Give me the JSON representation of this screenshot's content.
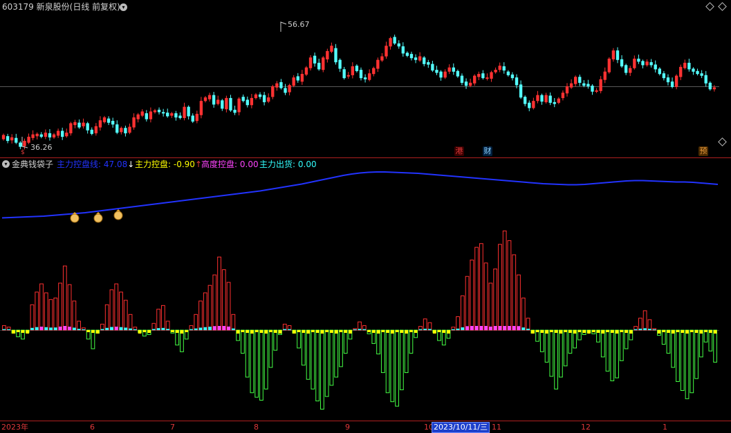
{
  "header": {
    "code": "603179",
    "name": "新泉股份",
    "mode": "(日线 前复权)"
  },
  "price_labels": {
    "high": "56.67",
    "low": "36.26"
  },
  "event_tags": [
    {
      "text": "港",
      "color": "#e03a3a"
    },
    {
      "text": "财",
      "color": "#8fd3ff"
    },
    {
      "text": "预",
      "color": "#e89a3c"
    },
    {
      "text": "$",
      "color": "#e03a3a"
    }
  ],
  "indicator": {
    "name": "金典钱袋子",
    "line1_label": "主力控盘线:",
    "line1_value": "47.08",
    "line1_arrow": "↓",
    "line2_label": "主力控盘:",
    "line2_value": "-0.90",
    "line2_arrow": "↑",
    "line3_label": "高度控盘:",
    "line3_value": "0.00",
    "line4_label": "主力出货:",
    "line4_value": "0.00",
    "colors": {
      "line1": "#2233ff",
      "line2": "#ffff00",
      "line3": "#ff44ff",
      "line4": "#33ffff"
    }
  },
  "x_axis": {
    "labels": [
      "2023年",
      "6",
      "7",
      "8",
      "9",
      "10",
      "11",
      "12",
      "1"
    ],
    "cursor_date": "2023/10/11/三"
  },
  "chart_data": {
    "type": "candlestick",
    "ylim": [
      34.5,
      58.5
    ],
    "n_days": 172,
    "candle_values": [
      [
        37.2,
        37.8
      ],
      [
        37.6,
        36.9
      ],
      [
        37.0,
        37.4
      ],
      [
        37.3,
        36.6
      ],
      [
        36.5,
        35.9
      ],
      [
        36.0,
        36.8
      ],
      [
        36.6,
        37.5
      ],
      [
        37.4,
        37.9
      ],
      [
        37.7,
        38.0
      ],
      [
        37.9,
        37.6
      ],
      [
        37.6,
        38.2
      ],
      [
        38.1,
        37.5
      ],
      [
        37.5,
        37.9
      ],
      [
        37.8,
        38.5
      ],
      [
        38.5,
        37.6
      ],
      [
        37.7,
        38.2
      ],
      [
        38.2,
        39.8
      ],
      [
        39.6,
        40.0
      ],
      [
        39.9,
        39.2
      ],
      [
        39.4,
        39.9
      ],
      [
        39.8,
        38.7
      ],
      [
        38.7,
        38.1
      ],
      [
        38.2,
        39.3
      ],
      [
        39.2,
        40.3
      ],
      [
        40.1,
        40.8
      ],
      [
        40.6,
        40.0
      ],
      [
        40.2,
        39.7
      ],
      [
        39.6,
        38.3
      ],
      [
        38.4,
        39.0
      ],
      [
        39.0,
        38.2
      ],
      [
        38.3,
        39.2
      ],
      [
        39.2,
        40.8
      ],
      [
        40.6,
        41.3
      ],
      [
        41.2,
        41.8
      ],
      [
        41.5,
        40.6
      ],
      [
        40.6,
        41.8
      ],
      [
        41.8,
        42.0
      ],
      [
        42.1,
        41.8
      ],
      [
        41.7,
        41.6
      ],
      [
        41.6,
        41.1
      ],
      [
        41.2,
        41.5
      ],
      [
        41.5,
        40.9
      ],
      [
        41.1,
        40.8
      ],
      [
        40.8,
        42.6
      ],
      [
        42.6,
        41.1
      ],
      [
        41.1,
        40.2
      ],
      [
        40.3,
        41.4
      ],
      [
        41.3,
        43.6
      ],
      [
        43.7,
        44.2
      ],
      [
        44.0,
        44.6
      ],
      [
        44.6,
        43.1
      ],
      [
        43.2,
        43.8
      ],
      [
        43.7,
        42.4
      ],
      [
        42.3,
        44.1
      ],
      [
        44.1,
        42.1
      ],
      [
        42.1,
        41.7
      ],
      [
        41.8,
        44.0
      ],
      [
        44.3,
        43.7
      ],
      [
        43.8,
        43.0
      ],
      [
        43.0,
        44.1
      ],
      [
        44.2,
        44.7
      ],
      [
        44.7,
        44.4
      ],
      [
        44.6,
        43.5
      ],
      [
        43.6,
        44.2
      ],
      [
        44.4,
        46.1
      ],
      [
        46.0,
        46.6
      ],
      [
        46.8,
        45.9
      ],
      [
        45.8,
        45.1
      ],
      [
        45.2,
        46.3
      ],
      [
        46.3,
        47.6
      ],
      [
        47.8,
        47.2
      ],
      [
        47.0,
        48.2
      ],
      [
        48.2,
        49.3
      ],
      [
        49.3,
        51.0
      ],
      [
        51.3,
        50.1
      ],
      [
        50.1,
        49.1
      ],
      [
        49.0,
        51.0
      ],
      [
        50.8,
        52.1
      ],
      [
        52.1,
        53.0
      ],
      [
        52.6,
        50.3
      ],
      [
        50.6,
        49.2
      ],
      [
        49.0,
        47.6
      ],
      [
        47.9,
        48.0
      ],
      [
        48.1,
        49.5
      ],
      [
        49.6,
        48.8
      ],
      [
        48.9,
        47.6
      ],
      [
        47.6,
        47.4
      ],
      [
        47.3,
        48.3
      ],
      [
        48.3,
        49.2
      ],
      [
        49.2,
        50.6
      ],
      [
        50.6,
        51.2
      ],
      [
        51.3,
        53.0
      ],
      [
        53.0,
        54.3
      ],
      [
        54.5,
        53.5
      ],
      [
        53.4,
        53.0
      ],
      [
        52.9,
        51.8
      ],
      [
        51.8,
        51.4
      ],
      [
        51.6,
        51.0
      ],
      [
        51.0,
        50.7
      ],
      [
        50.6,
        51.2
      ],
      [
        51.0,
        50.0
      ],
      [
        50.2,
        49.9
      ],
      [
        49.9,
        48.9
      ],
      [
        48.9,
        48.5
      ],
      [
        48.6,
        47.7
      ],
      [
        47.7,
        48.6
      ],
      [
        48.7,
        49.3
      ],
      [
        49.3,
        48.7
      ],
      [
        48.7,
        47.9
      ],
      [
        47.9,
        46.8
      ],
      [
        46.9,
        46.3
      ],
      [
        46.3,
        46.7
      ],
      [
        46.7,
        47.9
      ],
      [
        47.8,
        48.2
      ],
      [
        48.3,
        47.6
      ],
      [
        47.6,
        47.6
      ],
      [
        47.5,
        48.5
      ],
      [
        48.6,
        48.9
      ],
      [
        49.0,
        49.6
      ],
      [
        49.5,
        48.9
      ],
      [
        48.6,
        48.1
      ],
      [
        48.1,
        47.6
      ],
      [
        47.6,
        46.4
      ],
      [
        46.4,
        44.3
      ],
      [
        44.3,
        43.2
      ],
      [
        43.3,
        42.5
      ],
      [
        42.5,
        43.6
      ],
      [
        43.7,
        44.6
      ],
      [
        44.6,
        43.6
      ],
      [
        43.5,
        44.6
      ],
      [
        44.5,
        43.4
      ],
      [
        43.4,
        43.2
      ],
      [
        43.4,
        44.0
      ],
      [
        44.2,
        45.0
      ],
      [
        45.0,
        46.1
      ],
      [
        46.0,
        46.6
      ],
      [
        46.6,
        47.7
      ],
      [
        47.7,
        46.8
      ],
      [
        46.6,
        46.3
      ],
      [
        46.5,
        46.2
      ],
      [
        46.2,
        45.3
      ],
      [
        45.3,
        45.4
      ],
      [
        45.4,
        47.3
      ],
      [
        47.3,
        48.6
      ],
      [
        48.6,
        50.8
      ],
      [
        50.8,
        52.2
      ],
      [
        52.2,
        50.7
      ],
      [
        50.7,
        49.6
      ],
      [
        49.7,
        48.5
      ],
      [
        48.5,
        49.2
      ],
      [
        49.3,
        50.8
      ],
      [
        50.8,
        50.4
      ],
      [
        50.4,
        49.8
      ],
      [
        49.8,
        50.3
      ],
      [
        50.2,
        49.8
      ],
      [
        49.8,
        49.1
      ],
      [
        49.1,
        48.3
      ],
      [
        48.3,
        47.6
      ],
      [
        47.6,
        46.9
      ],
      [
        46.9,
        46.1
      ],
      [
        46.1,
        47.9
      ],
      [
        47.8,
        49.4
      ],
      [
        49.3,
        50.1
      ],
      [
        50.1,
        49.1
      ],
      [
        49.1,
        48.7
      ],
      [
        48.7,
        48.3
      ],
      [
        48.3,
        48.0
      ],
      [
        48.0,
        46.7
      ],
      [
        46.7,
        45.7
      ],
      [
        45.7,
        45.9
      ]
    ],
    "signal_line": [
      37.5,
      37.6,
      37.7,
      37.8,
      37.9,
      38.0,
      38.2,
      38.4,
      38.6,
      38.8,
      39.0,
      39.3,
      39.6,
      39.9,
      40.2,
      40.5,
      40.8,
      41.1,
      41.4,
      41.7,
      42.0,
      42.3,
      42.6,
      42.9,
      43.2,
      43.5,
      43.8,
      44.1,
      44.4,
      44.7,
      45.0,
      45.3,
      45.7,
      46.1,
      46.5,
      46.9,
      47.3,
      47.8,
      48.3,
      48.8,
      49.3,
      49.8,
      50.2,
      50.5,
      50.7,
      50.8,
      50.8,
      50.7,
      50.6,
      50.5,
      50.4,
      50.2,
      50.0,
      49.8,
      49.6,
      49.4,
      49.2,
      49.0,
      48.8,
      48.6,
      48.4,
      48.2,
      48.0,
      47.8,
      47.6,
      47.4,
      47.3,
      47.2,
      47.1,
      47.1,
      47.2,
      47.4,
      47.6,
      47.8,
      48.0,
      48.2,
      48.3,
      48.3,
      48.2,
      48.1,
      48.0,
      47.9,
      47.9,
      47.8,
      47.6,
      47.4,
      47.2
    ],
    "histogram": [
      0.6,
      0.4,
      -0.4,
      -0.9,
      -1.2,
      -0.3,
      3.4,
      5.1,
      6.2,
      5.0,
      4.1,
      4.3,
      6.3,
      8.6,
      6.1,
      3.9,
      1.2,
      0.3,
      -1.2,
      -2.5,
      -0.4,
      0.8,
      3.4,
      5.4,
      6.2,
      5.1,
      4.0,
      2.1,
      0.4,
      -0.3,
      -0.8,
      -0.6,
      0.9,
      2.8,
      3.3,
      1.2,
      -0.4,
      -2.0,
      -2.9,
      -1.2,
      0.6,
      2.1,
      3.9,
      5.0,
      6.0,
      7.4,
      9.8,
      8.1,
      6.4,
      2.1,
      -1.4,
      -3.1,
      -6.3,
      -8.4,
      -9.0,
      -9.4,
      -7.9,
      -5.0,
      -2.7,
      -0.6,
      0.8,
      0.6,
      -0.4,
      -2.4,
      -4.7,
      -6.6,
      -7.9,
      -9.5,
      -10.6,
      -8.9,
      -7.4,
      -6.3,
      -4.9,
      -3.1,
      -1.2,
      0.2,
      1.1,
      0.6,
      -0.5,
      -1.8,
      -3.2,
      -5.7,
      -8.4,
      -9.6,
      -10.2,
      -8.0,
      -5.7,
      -3.1,
      -1.0,
      0.5,
      1.5,
      1.0,
      -0.3,
      -1.4,
      -2.0,
      -1.1,
      0.4,
      1.8,
      4.6,
      7.2,
      9.4,
      11.1,
      11.6,
      9.0,
      6.3,
      8.2,
      11.5,
      13.3,
      12.0,
      10.1,
      7.4,
      4.3,
      1.6,
      -0.4,
      -1.5,
      -2.9,
      -4.3,
      -6.2,
      -7.9,
      -6.3,
      -4.8,
      -3.1,
      -2.4,
      -1.3,
      -0.6,
      -0.3,
      -0.5,
      -1.6,
      -3.6,
      -5.5,
      -6.8,
      -6.4,
      -4.1,
      -2.5,
      -1.3,
      0.5,
      1.6,
      2.6,
      1.4,
      0.2,
      -0.7,
      -1.9,
      -3.1,
      -5.0,
      -6.9,
      -8.1,
      -9.2,
      -8.4,
      -6.5,
      -3.6,
      -1.6,
      -2.8,
      -4.3
    ]
  }
}
